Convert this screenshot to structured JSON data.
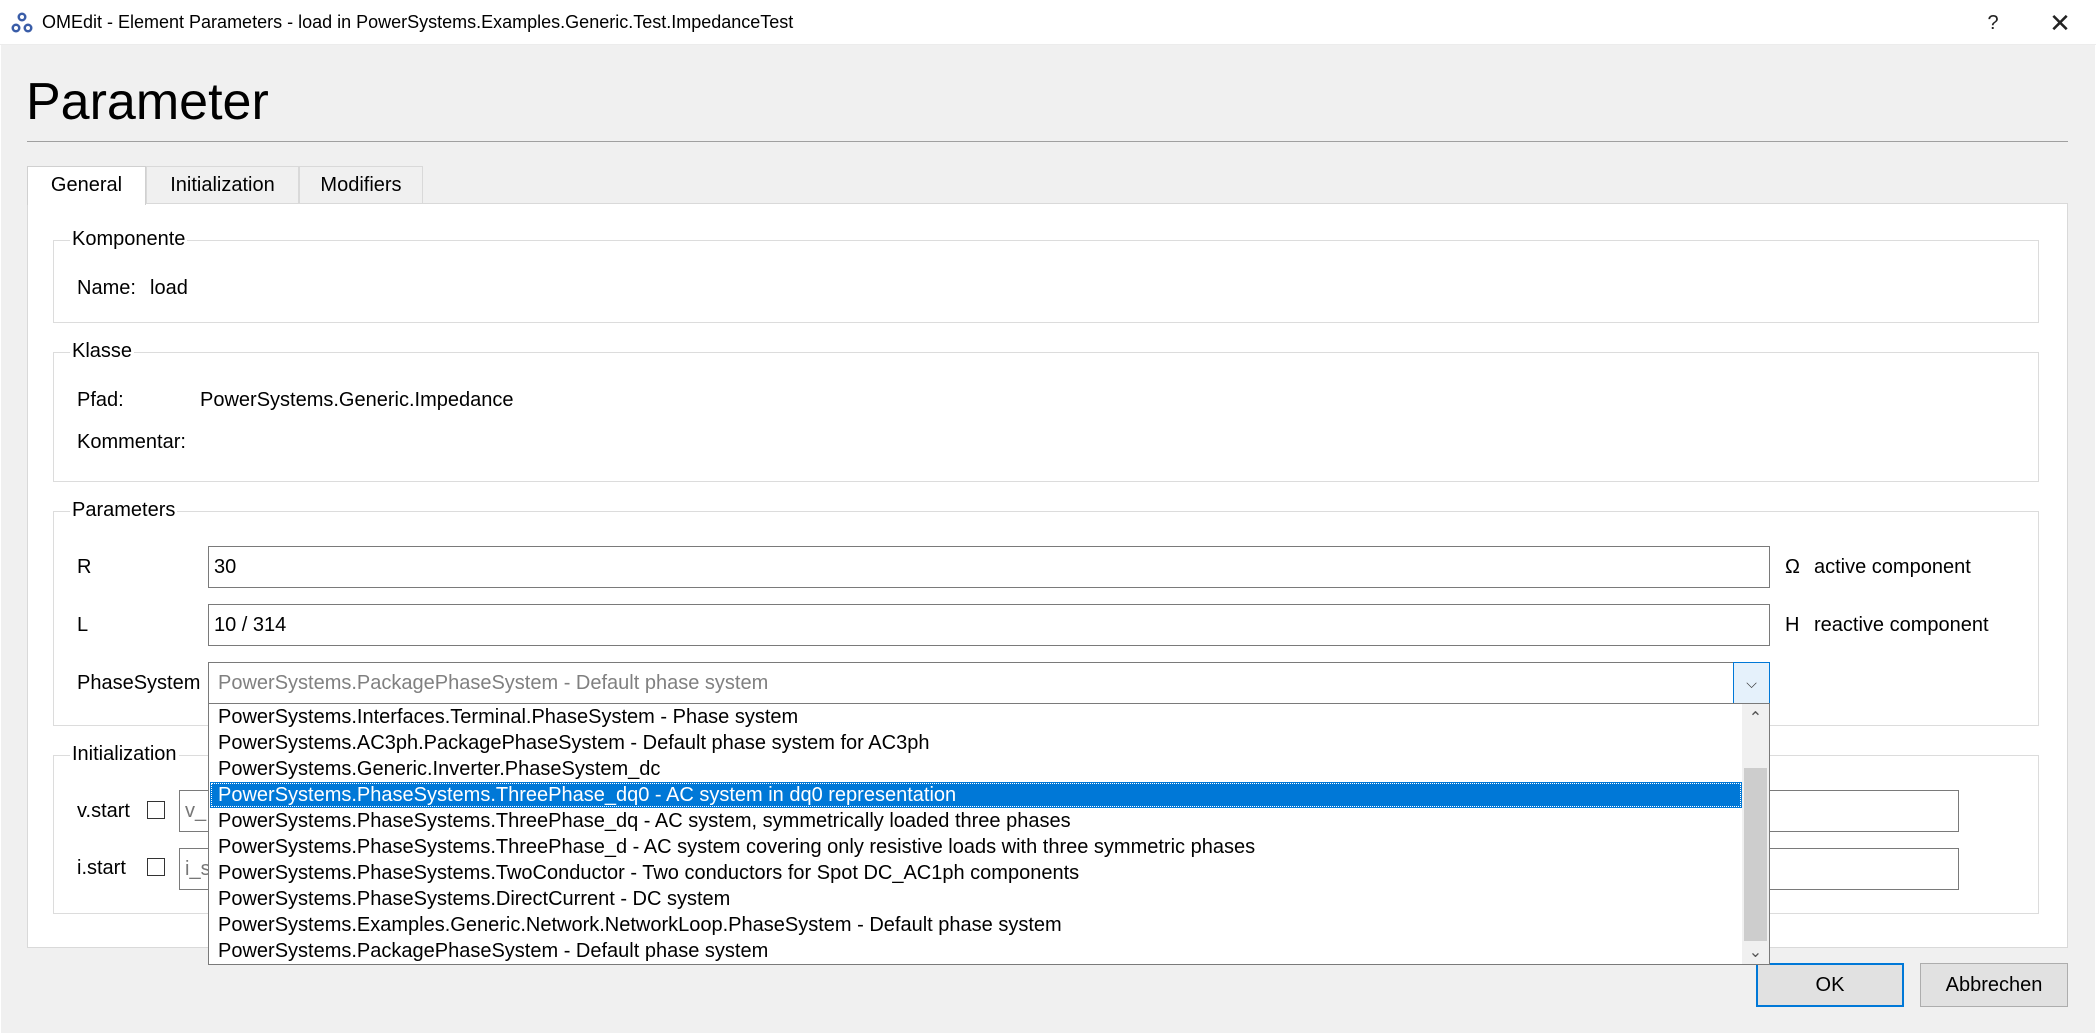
{
  "window": {
    "title": "OMEdit - Element Parameters - load in PowerSystems.Examples.Generic.Test.ImpedanceTest",
    "help_label": "?",
    "close_label": "✕"
  },
  "heading": "Parameter",
  "tabs": [
    {
      "label": "General",
      "active": true
    },
    {
      "label": "Initialization",
      "active": false
    },
    {
      "label": "Modifiers",
      "active": false
    }
  ],
  "komponente": {
    "title": "Komponente",
    "name_label": "Name:",
    "name_value": "load"
  },
  "klasse": {
    "title": "Klasse",
    "pfad_label": "Pfad:",
    "pfad_value": "PowerSystems.Generic.Impedance",
    "kommentar_label": "Kommentar:"
  },
  "parameters": {
    "title": "Parameters",
    "rows": [
      {
        "name": "R",
        "value": "30",
        "unit": "Ω",
        "comment": "active component"
      },
      {
        "name": "L",
        "value": "10 / 314",
        "unit": "H",
        "comment": "reactive component"
      }
    ],
    "phase_system": {
      "label": "PhaseSystem",
      "selected": "PowerSystems.PackagePhaseSystem - Default phase system"
    }
  },
  "initialization": {
    "title": "Initialization",
    "rows": [
      {
        "name": "v.start",
        "placeholder": "v_"
      },
      {
        "name": "i.start",
        "placeholder": "i_s"
      }
    ]
  },
  "dropdown": {
    "options": [
      "PowerSystems.Interfaces.Terminal.PhaseSystem - Phase system",
      "PowerSystems.AC3ph.PackagePhaseSystem - Default phase system for AC3ph",
      "PowerSystems.Generic.Inverter.PhaseSystem_dc",
      "PowerSystems.PhaseSystems.ThreePhase_dq0 - AC system in dq0 representation",
      "PowerSystems.PhaseSystems.ThreePhase_dq - AC system, symmetrically loaded three phases",
      "PowerSystems.PhaseSystems.ThreePhase_d - AC system covering only resistive loads with three symmetric phases",
      "PowerSystems.PhaseSystems.TwoConductor - Two conductors for Spot DC_AC1ph components",
      "PowerSystems.PhaseSystems.DirectCurrent - DC system",
      "PowerSystems.Examples.Generic.Network.NetworkLoop.PhaseSystem - Default phase system",
      "PowerSystems.PackagePhaseSystem - Default phase system"
    ],
    "highlighted_index": 3
  },
  "buttons": {
    "ok": "OK",
    "cancel": "Abbrechen"
  },
  "colors": {
    "selection": "#0078d7",
    "dialog_bg": "#f0f0f0"
  }
}
